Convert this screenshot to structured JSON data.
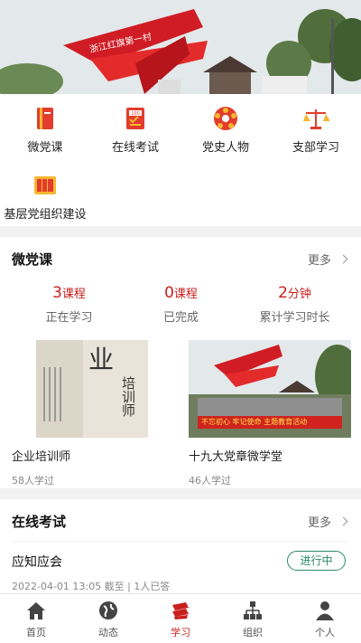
{
  "banner": {
    "monument_text": "浙江红旗第一村"
  },
  "quick_menu": [
    {
      "label": "微党课",
      "icon": "book-icon"
    },
    {
      "label": "在线考试",
      "icon": "exam-paper-icon"
    },
    {
      "label": "党史人物",
      "icon": "badge-icon"
    },
    {
      "label": "支部学习",
      "icon": "scales-icon"
    },
    {
      "label": "基层党组织建设",
      "icon": "bookshelf-icon"
    }
  ],
  "micro_lesson": {
    "title": "微党课",
    "more_label": "更多",
    "stats": [
      {
        "number": "3",
        "unit": "课程",
        "caption": "正在学习"
      },
      {
        "number": "0",
        "unit": "课程",
        "caption": "已完成"
      },
      {
        "number": "2",
        "unit": "分钟",
        "caption": "累计学习时长"
      }
    ],
    "courses": [
      {
        "title": "企业培训师",
        "learners": "58人学过",
        "cover_text_main": "培训师",
        "cover_text_big": "业"
      },
      {
        "title": "十九大党章微学堂",
        "learners": "46人学过",
        "cover_banner_text": "不忘初心 牢记使命 主题教育活动"
      }
    ]
  },
  "online_exam": {
    "title": "在线考试",
    "more_label": "更多",
    "items": [
      {
        "name": "应知应会",
        "meta": "2022-04-01 13:05 截至 | 1人已答",
        "status": "进行中"
      }
    ]
  },
  "tabbar": [
    {
      "label": "首页",
      "icon": "home-icon"
    },
    {
      "label": "动态",
      "icon": "globe-icon"
    },
    {
      "label": "学习",
      "icon": "study-icon",
      "active": true
    },
    {
      "label": "组织",
      "icon": "org-chart-icon"
    },
    {
      "label": "个人",
      "icon": "person-icon"
    }
  ],
  "colors": {
    "accent": "#c8201e",
    "status_green": "#2a8a64"
  }
}
